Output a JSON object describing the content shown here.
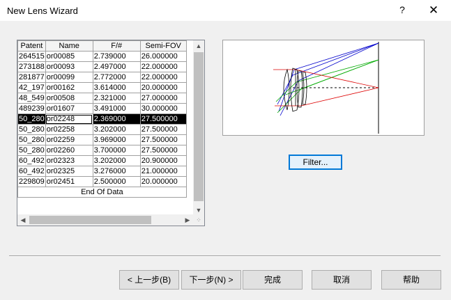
{
  "window": {
    "title": "New Lens Wizard",
    "help": "?",
    "close": "✕"
  },
  "grid": {
    "headers": [
      "Patent",
      "Name",
      "F/#",
      "Semi-FOV"
    ],
    "rows": [
      [
        "264515",
        "or00085",
        "2.739000",
        "26.000000"
      ],
      [
        "273188",
        "or00093",
        "2.497000",
        "22.000000"
      ],
      [
        "281877",
        "or00099",
        "2.772000",
        "22.000000"
      ],
      [
        "42_197",
        "or00162",
        "3.614000",
        "20.000000"
      ],
      [
        "48_549",
        "or00508",
        "2.321000",
        "27.000000"
      ],
      [
        "489239",
        "or01607",
        "3.491000",
        "30.000000"
      ],
      [
        "50_280",
        "or02248",
        "2.369000",
        "27.500000"
      ],
      [
        "50_280",
        "or02258",
        "3.202000",
        "27.500000"
      ],
      [
        "50_280",
        "or02259",
        "3.969000",
        "27.500000"
      ],
      [
        "50_280",
        "or02260",
        "3.700000",
        "27.500000"
      ],
      [
        "60_492",
        "or02323",
        "3.202000",
        "20.900000"
      ],
      [
        "60_492",
        "or02325",
        "3.276000",
        "21.000000"
      ],
      [
        "229809",
        "or02451",
        "2.500000",
        "20.000000"
      ]
    ],
    "selected_row": 6,
    "end_label": "End Of Data"
  },
  "scroll": {
    "up": "▲",
    "down": "▼",
    "left": "◀",
    "right": "▶",
    "grip": "⁘"
  },
  "filter_button": "Filter...",
  "buttons": {
    "back": "< 上一步(B)",
    "next": "下一步(N) >",
    "finish": "完成",
    "cancel": "取消",
    "help": "帮助"
  },
  "colors": {
    "ray_blue": "#0000cc",
    "ray_green": "#00aa00",
    "ray_red": "#dd0000"
  }
}
